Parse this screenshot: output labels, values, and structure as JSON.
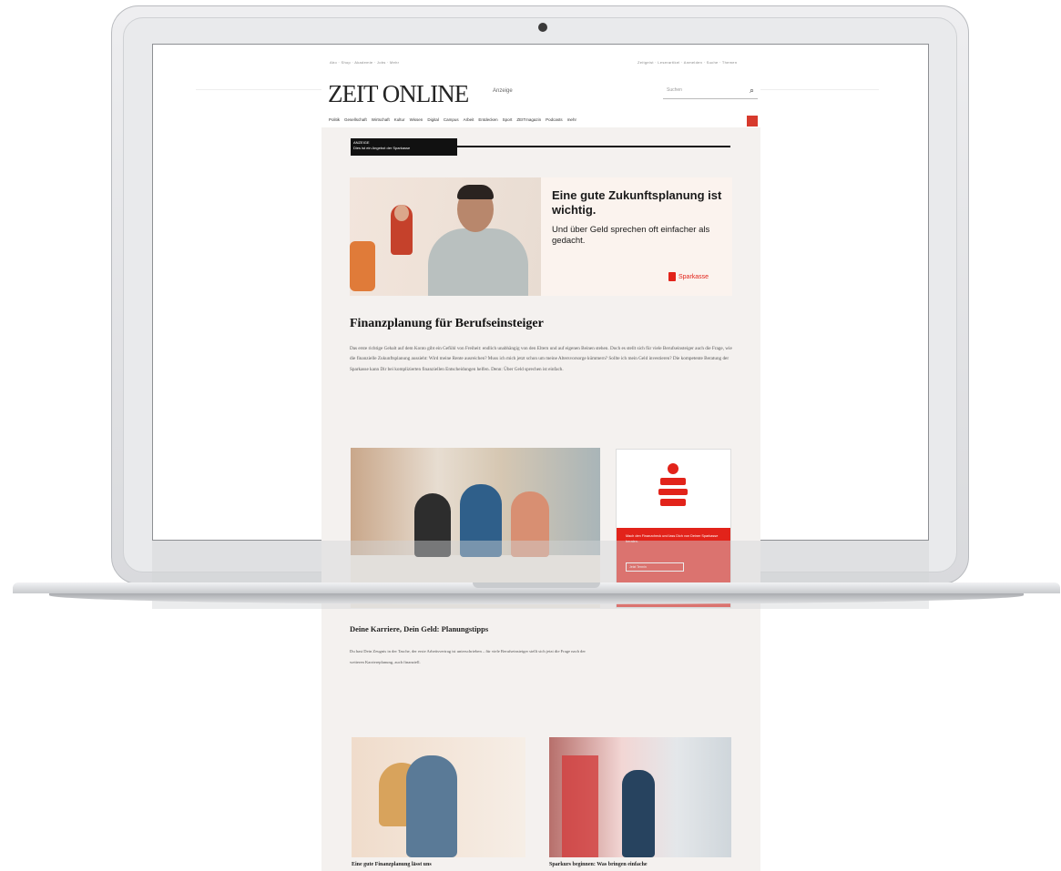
{
  "site": {
    "logo": "ZEIT ONLINE",
    "anzeige": "Anzeige",
    "utility_left": "Abo · Shop · Akademie · Jobs · Mehr",
    "utility_right": "Zeitgeist · Leserartikel · Anmelden · Suche · Themen",
    "search_placeholder": "Suchen"
  },
  "nav": {
    "items": [
      "Politik",
      "Gesellschaft",
      "Wirtschaft",
      "Kultur",
      "Wissen",
      "Digital",
      "Campus",
      "Arbeit",
      "Entdecken",
      "Sport",
      "ZEITmagazin",
      "Podcasts",
      "mehr"
    ]
  },
  "ad_label": {
    "line1": "ANZEIGE",
    "line2": "Dies ist ein Angebot der Sparkasse"
  },
  "hero": {
    "title": "Eine gute Zukunftsplanung ist wichtig.",
    "subtitle": "Und über Geld sprechen oft einfacher als gedacht.",
    "brand": "Sparkasse"
  },
  "article": {
    "title": "Finanzplanung für Berufseinsteiger",
    "body": "Das erste richtige Gehalt auf dem Konto gibt ein Gefühl von Freiheit: endlich unabhängig von den Eltern und auf eigenen Beinen stehen. Doch es stellt sich für viele Berufseinsteiger auch die Frage, wie die finanzielle Zukunftsplanung aussieht: Wird meine Rente ausreichen? Muss ich mich jetzt schon um meine Altersvorsorge kümmern? Sollte ich mein Geld investieren? Die kompetente Beratung der Sparkasse kann Dir bei komplizierten finanziellen Entscheidungen helfen. Denn: Über Geld sprechen ist einfach."
  },
  "promo": {
    "text": "Mach den Finanzcheck und lass Dich von Deiner Sparkasse beraten.",
    "button": "Jetzt Termin"
  },
  "section2": {
    "title": "Deine Karriere, Dein Geld: Planungstipps",
    "body": "Du hast Dein Zeugnis in der Tasche, der erste Arbeitsvertrag ist unterschrieben – für viele Berufseinsteiger stellt sich jetzt die Frage nach der weiteren Karriereplanung, auch finanziell."
  },
  "teasers": {
    "caption1": "Eine gute Finanzplanung lässt uns",
    "caption2": "Sparkurs beginnen: Was bringen einfache"
  },
  "colors": {
    "sparkasse_red": "#e2231a",
    "page_bg": "#f4f1ef"
  }
}
